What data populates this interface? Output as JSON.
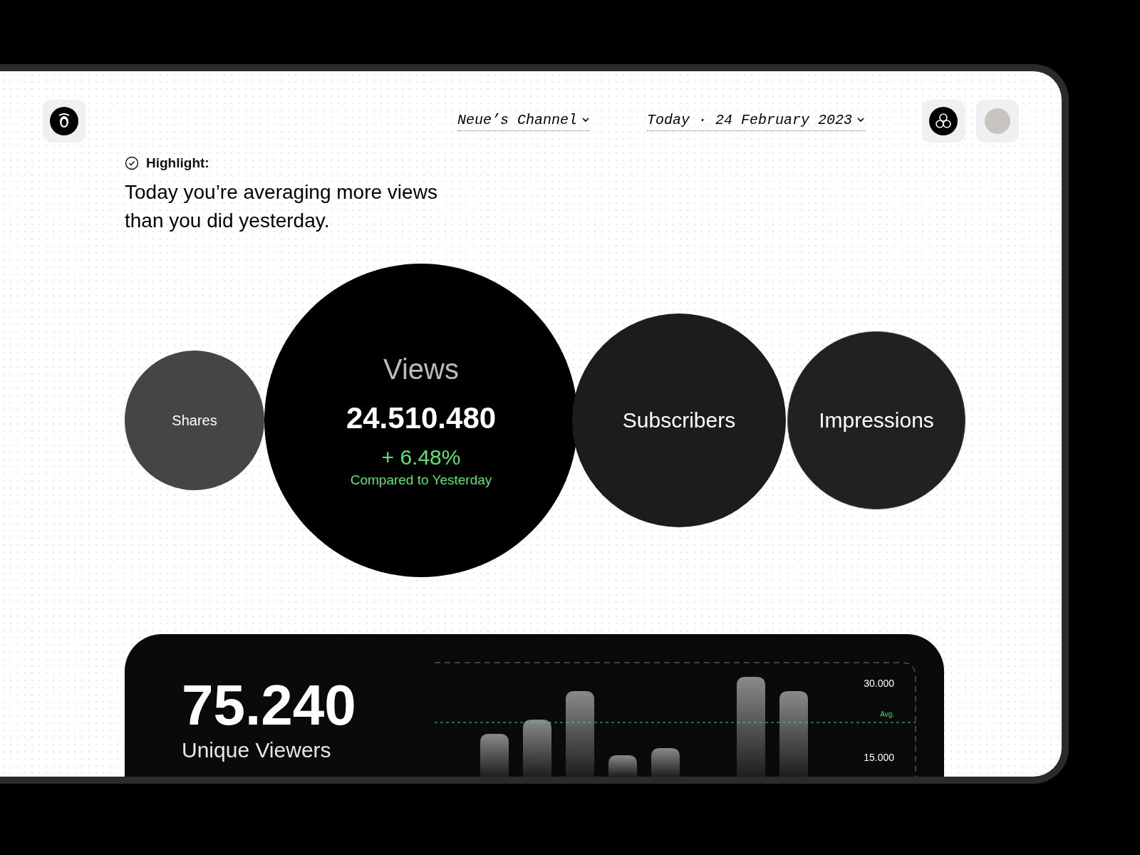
{
  "header": {
    "channel": "Neue’s Channel",
    "date": "Today · 24 February 2023"
  },
  "highlight": {
    "label": "Highlight:",
    "text": "Today you’re averaging more views than you did yesterday."
  },
  "metrics": [
    {
      "label": "Shares",
      "selected": false
    },
    {
      "label": "Views",
      "selected": true,
      "value": "24.510.480",
      "change": "+ 6.48%",
      "comparison": "Compared to Yesterday"
    },
    {
      "label": "Subscribers",
      "selected": false
    },
    {
      "label": "Impressions",
      "selected": false
    }
  ],
  "unique_viewers": {
    "value": "75.240",
    "label": "Unique Viewers",
    "axis_labels": [
      "30.000",
      "15.000"
    ],
    "average_label": "Avg."
  }
}
